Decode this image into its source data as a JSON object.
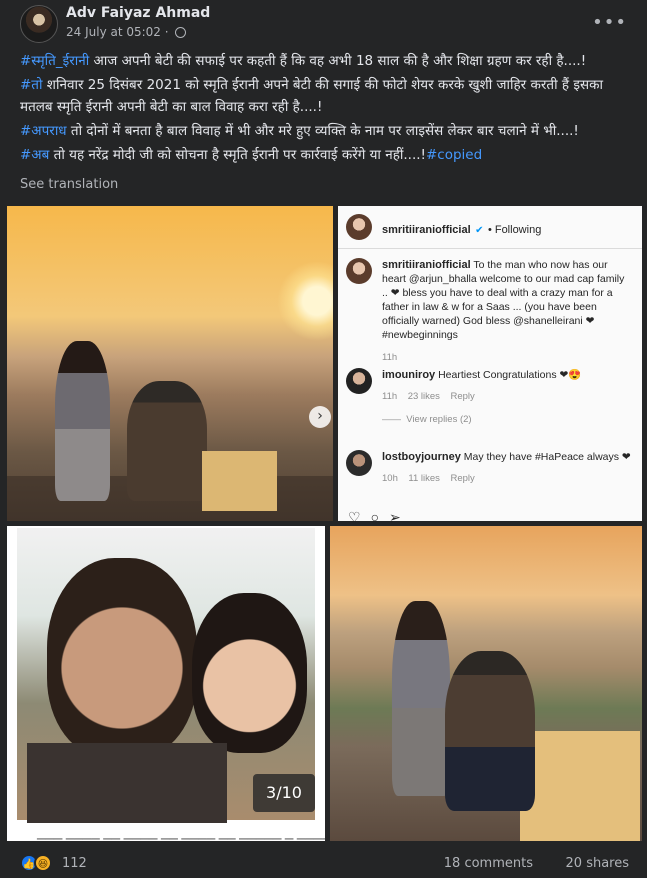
{
  "post": {
    "author": "Adv Faiyaz Ahmad",
    "timestamp": "24 July at 05:02 ·",
    "more_icon": "more-horizontal-icon",
    "privacy_icon": "globe-icon",
    "lines": [
      {
        "tag": "#स्मृति_ईरानी",
        "text": " आज अपनी बेटी की सफाई पर कहती हैं कि वह अभी 18 साल की है और शिक्षा ग्रहण कर रही है....!"
      },
      {
        "tag": "#तो",
        "text": " शनिवार 25 दिसंबर 2021 को स्मृति ईरानी अपने बेटी की सगाई की फोटो शेयर करके खुशी जाहिर करती हैं इसका मतलब स्मृति ईरानी अपनी बेटी का बाल विवाह करा रही है....!"
      },
      {
        "tag": "#अपराध",
        "text": " तो दोनों में बनता है बाल विवाह में भी और मरे हुए व्यक्ति के नाम पर लाइसेंस लेकर बार चलाने में भी....!"
      },
      {
        "tag": "#अब",
        "text": " तो यह नरेंद्र मोदी जी को सोचना है स्मृति ईरानी पर कार्रवाई करेंगे या नहीं....!",
        "tag2": "#copied"
      }
    ],
    "see_translation": "See translation"
  },
  "instagram": {
    "header_user": "smritiiraniofficial",
    "header_follow": "• Following",
    "caption_user": "smritiiraniofficial",
    "caption": "To the man who now has our heart @arjun_bhalla welcome to our mad cap family .. ❤ bless you have to deal with a crazy man for a father in law & w for a Saas ... (you have been officially warned) God bless @shanelleirani ❤ #newbeginnings",
    "caption_time": "11h",
    "comments": [
      {
        "user": "imouniroy",
        "text": "Heartiest Congratulations ❤😍",
        "time": "11h",
        "likes": "23 likes",
        "reply": "Reply",
        "view_replies": "View replies (2)"
      },
      {
        "user": "lostboyjourney",
        "text": "May they have #HaPeace always ❤",
        "time": "10h",
        "likes": "11 likes",
        "reply": "Reply"
      }
    ]
  },
  "gallery": {
    "counter": "3/10"
  },
  "footer": {
    "reaction_count": "112",
    "comments": "18 comments",
    "shares": "20 shares"
  }
}
